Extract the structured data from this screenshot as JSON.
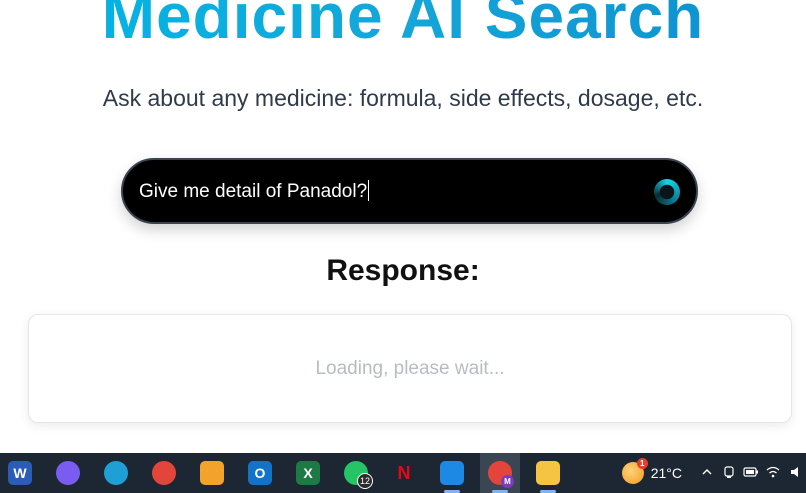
{
  "hero": {
    "title": "Medicine AI Search",
    "subtitle": "Ask about any medicine: formula, side effects, dosage, etc."
  },
  "search": {
    "value": "Give me detail of Panadol?",
    "status_icon": "loading-spinner-icon"
  },
  "response": {
    "heading": "Response:",
    "loading_text": "Loading, please wait..."
  },
  "taskbar": {
    "apps": [
      {
        "name": "word",
        "glyph": "W",
        "color": "#2b5cb8"
      },
      {
        "name": "copilot",
        "glyph": "",
        "color": "#7b5cf0"
      },
      {
        "name": "edge",
        "glyph": "",
        "color": "#1ea0d6"
      },
      {
        "name": "chrome",
        "glyph": "",
        "color": "#e4453a"
      },
      {
        "name": "microsoft-store",
        "glyph": "",
        "color": "#f3a32a"
      },
      {
        "name": "outlook",
        "glyph": "O",
        "color": "#1373c9"
      },
      {
        "name": "excel",
        "glyph": "X",
        "color": "#1e7a45"
      },
      {
        "name": "whatsapp",
        "glyph": "",
        "color": "#25c464",
        "badge": "12"
      },
      {
        "name": "netflix",
        "glyph": "N",
        "color": "#1c2733",
        "text_color": "#e50914"
      },
      {
        "name": "vscode",
        "glyph": "",
        "color": "#1e88e5"
      },
      {
        "name": "chrome-profile",
        "glyph": "",
        "color": "#e4453a",
        "badge_m": "M"
      },
      {
        "name": "file-explorer",
        "glyph": "",
        "color": "#f5c542"
      }
    ],
    "weather": {
      "temp": "21°C",
      "badge": "1"
    },
    "tray_icons": [
      "chevron-up-icon",
      "meet-now-icon",
      "battery-icon",
      "wifi-icon",
      "volume-icon"
    ]
  }
}
